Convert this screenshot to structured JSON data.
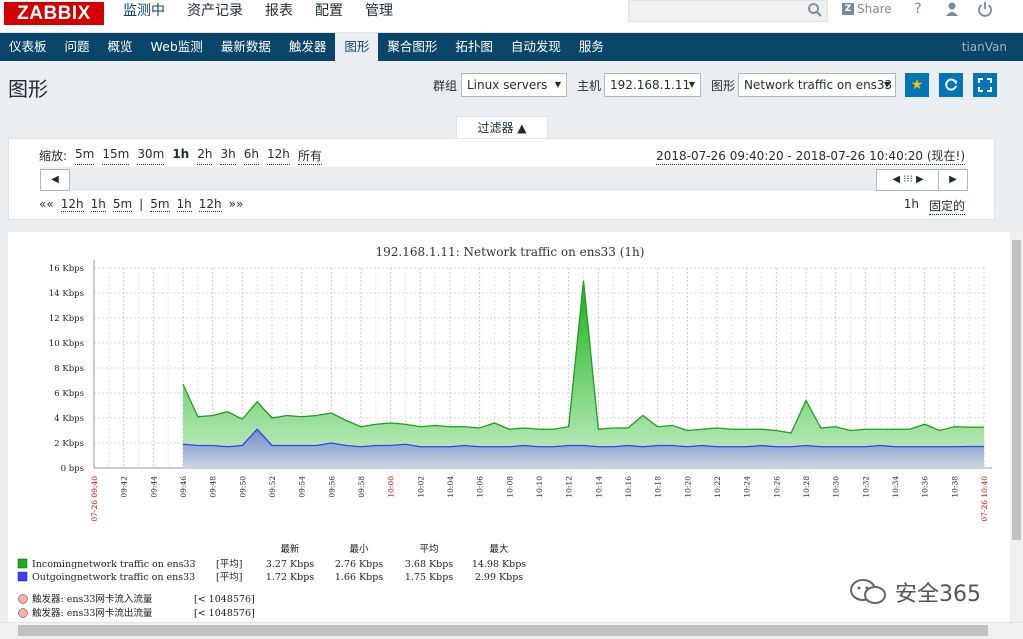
{
  "app": {
    "logo": "ZABBIX"
  },
  "top_menu": [
    "监测中",
    "资产记录",
    "报表",
    "配置",
    "管理"
  ],
  "share_label": "Share",
  "nav": {
    "items": [
      "仪表板",
      "问题",
      "概览",
      "Web监测",
      "最新数据",
      "触发器",
      "图形",
      "聚合图形",
      "拓扑图",
      "自动发现",
      "服务"
    ],
    "active": "图形",
    "user": "tianVan"
  },
  "header": {
    "title": "图形",
    "group_label": "群组",
    "group_value": "Linux servers",
    "host_label": "主机",
    "host_value": "192.168.1.11",
    "graph_label": "图形",
    "graph_value": "Network traffic on ens33"
  },
  "filter": {
    "tab_label": "过滤器 ▲",
    "zoom_label": "缩放:",
    "zoom_options": [
      "5m",
      "15m",
      "30m",
      "1h",
      "2h",
      "3h",
      "6h",
      "12h",
      "所有"
    ],
    "zoom_current": "1h",
    "date_range": "2018-07-26 09:40:20 - 2018-07-26 10:40:20 (现在!)",
    "step_left": [
      "««",
      "12h",
      "1h",
      "5m",
      "|",
      "5m",
      "1h",
      "12h",
      "»»"
    ],
    "period": "1h",
    "fixed_label": "固定的"
  },
  "chart_data": {
    "type": "area",
    "title": "192.168.1.11: Network traffic on ens33 (1h)",
    "ylabel": "",
    "y_ticks": [
      "0 bps",
      "2 Kbps",
      "4 Kbps",
      "6 Kbps",
      "8 Kbps",
      "10 Kbps",
      "12 Kbps",
      "14 Kbps",
      "16 Kbps"
    ],
    "ylim": [
      0,
      16
    ],
    "y_unit": "Kbps",
    "x_start_label": "07-26 09:40",
    "x_end_label": "07-26 10:40",
    "x_ticks": [
      "09:42",
      "09:44",
      "09:46",
      "09:48",
      "09:50",
      "09:52",
      "09:54",
      "09:56",
      "09:58",
      "10:00",
      "10:02",
      "10:04",
      "10:06",
      "10:08",
      "10:10",
      "10:12",
      "10:14",
      "10:16",
      "10:18",
      "10:20",
      "10:22",
      "10:24",
      "10:26",
      "10:28",
      "10:30",
      "10:32",
      "10:34",
      "10:36",
      "10:38"
    ],
    "x_minutes": [
      6,
      7,
      8,
      9,
      10,
      11,
      12,
      13,
      14,
      15,
      16,
      17,
      18,
      19,
      20,
      21,
      22,
      23,
      24,
      25,
      26,
      27,
      28,
      29,
      30,
      31,
      32,
      33,
      34,
      35,
      36,
      37,
      38,
      39,
      40,
      41,
      42,
      43,
      44,
      45,
      46,
      47,
      48,
      49,
      50,
      51,
      52,
      53,
      54,
      55,
      56,
      57,
      58,
      59,
      60
    ],
    "series": [
      {
        "name": "Incomingnetwork traffic on ens33",
        "color": "#1aaf1a",
        "values": [
          6.7,
          4.1,
          4.2,
          4.5,
          3.9,
          5.3,
          4.0,
          4.2,
          4.1,
          4.2,
          4.4,
          3.8,
          3.3,
          3.5,
          3.6,
          3.5,
          3.3,
          3.4,
          3.3,
          3.3,
          3.2,
          3.6,
          3.1,
          3.2,
          3.1,
          3.1,
          3.3,
          14.98,
          3.1,
          3.2,
          3.2,
          4.2,
          3.3,
          3.4,
          3.0,
          3.1,
          3.2,
          3.1,
          3.1,
          3.1,
          3.0,
          2.8,
          5.4,
          3.2,
          3.3,
          3.0,
          3.1,
          3.1,
          3.1,
          3.1,
          3.5,
          3.0,
          3.3,
          3.27,
          3.27
        ]
      },
      {
        "name": "Outgoingnetwork traffic on ens33",
        "color": "#3c3cff",
        "values": [
          1.9,
          1.8,
          1.8,
          1.7,
          1.8,
          3.1,
          1.8,
          1.8,
          1.8,
          1.8,
          2.0,
          1.8,
          1.7,
          1.8,
          1.8,
          1.9,
          1.7,
          1.7,
          1.7,
          1.8,
          1.7,
          1.7,
          1.7,
          1.8,
          1.7,
          1.7,
          1.8,
          1.8,
          1.7,
          1.7,
          1.8,
          1.7,
          1.8,
          1.8,
          1.7,
          1.8,
          1.7,
          1.7,
          1.7,
          1.8,
          1.7,
          1.7,
          1.8,
          1.7,
          1.7,
          1.7,
          1.7,
          1.8,
          1.7,
          1.7,
          1.7,
          1.7,
          1.7,
          1.72,
          1.72
        ]
      }
    ],
    "legend_headers": [
      "最新",
      "最小",
      "平均",
      "最大"
    ],
    "legend_rows": [
      {
        "name": "Incomingnetwork traffic on ens33",
        "func": "[平均]",
        "last": "3.27 Kbps",
        "min": "2.76 Kbps",
        "avg": "3.68 Kbps",
        "max": "14.98 Kbps",
        "color": "#1aaf1a"
      },
      {
        "name": "Outgoingnetwork traffic on ens33",
        "func": "[平均]",
        "last": "1.72 Kbps",
        "min": "1.66 Kbps",
        "avg": "1.75 Kbps",
        "max": "2.99 Kbps",
        "color": "#3c3cff"
      }
    ],
    "triggers": [
      {
        "name": "触发器: ens33网卡流入流量",
        "value": "[< 1048576]"
      },
      {
        "name": "触发器: ens33网卡流出流量",
        "value": "[< 1048576]"
      }
    ]
  },
  "watermark": "安全365",
  "colors": {
    "accent": "#0275b8",
    "nav": "#0a466a",
    "logo": "#d40000"
  }
}
